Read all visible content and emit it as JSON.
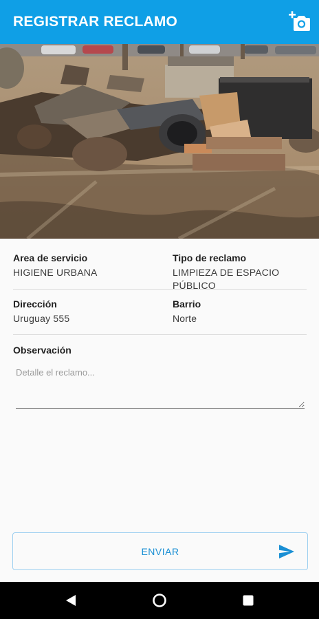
{
  "appbar": {
    "title": "REGISTRAR RECLAMO",
    "action_icon": "add-photo-icon",
    "color": "#0f9fe6"
  },
  "photo": {
    "icon": "photo-of-debris"
  },
  "details": {
    "area_label": "Area de servicio",
    "area_value": "HIGIENE URBANA",
    "tipo_label": "Tipo de reclamo",
    "tipo_value_line1": "LIMPIEZA DE ESPACIO",
    "tipo_value_line2": "PÚBLICO",
    "direccion_label": "Dirección",
    "direccion_value": "Uruguay 555",
    "barrio_label": "Barrio",
    "barrio_value": "Norte",
    "observacion_label": "Observación",
    "observacion_placeholder": "Detalle el reclamo...",
    "observacion_value": ""
  },
  "actions": {
    "send_label": "ENVIAR",
    "send_icon": "send-icon",
    "accent": "#1a8fd4"
  },
  "navbar": {
    "back_icon": "back-triangle-icon",
    "home_icon": "home-circle-icon",
    "recents_icon": "recents-square-icon"
  }
}
